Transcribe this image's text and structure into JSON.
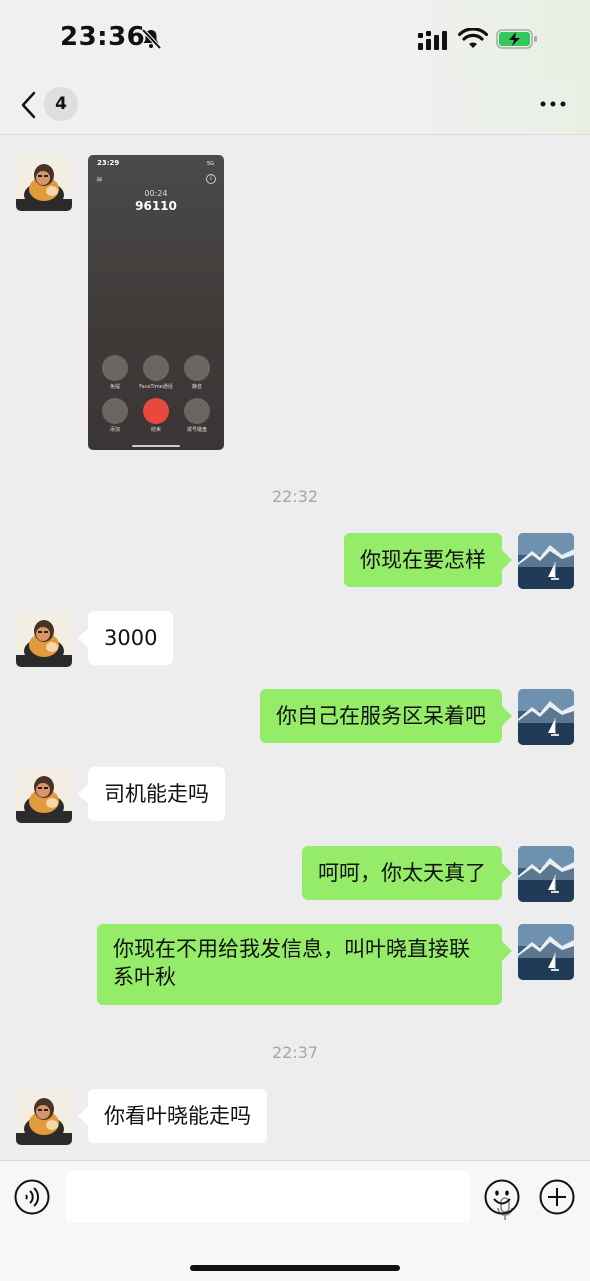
{
  "status_bar": {
    "time": "23:36",
    "silent_icon": "bell-slash-icon",
    "signal_icon": "cellular-signal-icon",
    "wifi_icon": "wifi-icon",
    "battery_icon": "battery-charging-icon"
  },
  "nav": {
    "unread_count": "4",
    "back_icon": "chevron-left-icon",
    "more_icon": "ellipsis-icon"
  },
  "call_screenshot": {
    "status_time": "23:29",
    "network": "5G",
    "duration": "00:24",
    "number": "96110",
    "buttons": [
      "免提",
      "FaceTime通话",
      "静音",
      "添加",
      "结束",
      "拨号键盘"
    ]
  },
  "messages": [
    {
      "type": "timestamp",
      "text": "22:32"
    },
    {
      "side": "out",
      "text": "你现在要怎样"
    },
    {
      "side": "in",
      "text": "3000"
    },
    {
      "side": "out",
      "text": "你自己在服务区呆着吧"
    },
    {
      "side": "in",
      "text": "司机能走吗"
    },
    {
      "side": "out",
      "text": "呵呵，你太天真了"
    },
    {
      "side": "out",
      "text": "你现在不用给我发信息，叫叶晓直接联系叶秋"
    },
    {
      "type": "timestamp",
      "text": "22:37"
    },
    {
      "side": "in",
      "text": "你看叶晓能走吗"
    }
  ],
  "input_bar": {
    "voice_icon": "voice-icon",
    "mic_icon": "mic-icon",
    "emoji_icon": "emoji-icon",
    "plus_icon": "plus-icon"
  },
  "colors": {
    "background": "#ededed",
    "outgoing_bubble": "#95ec69",
    "incoming_bubble": "#ffffff",
    "end_call": "#e8483d"
  }
}
